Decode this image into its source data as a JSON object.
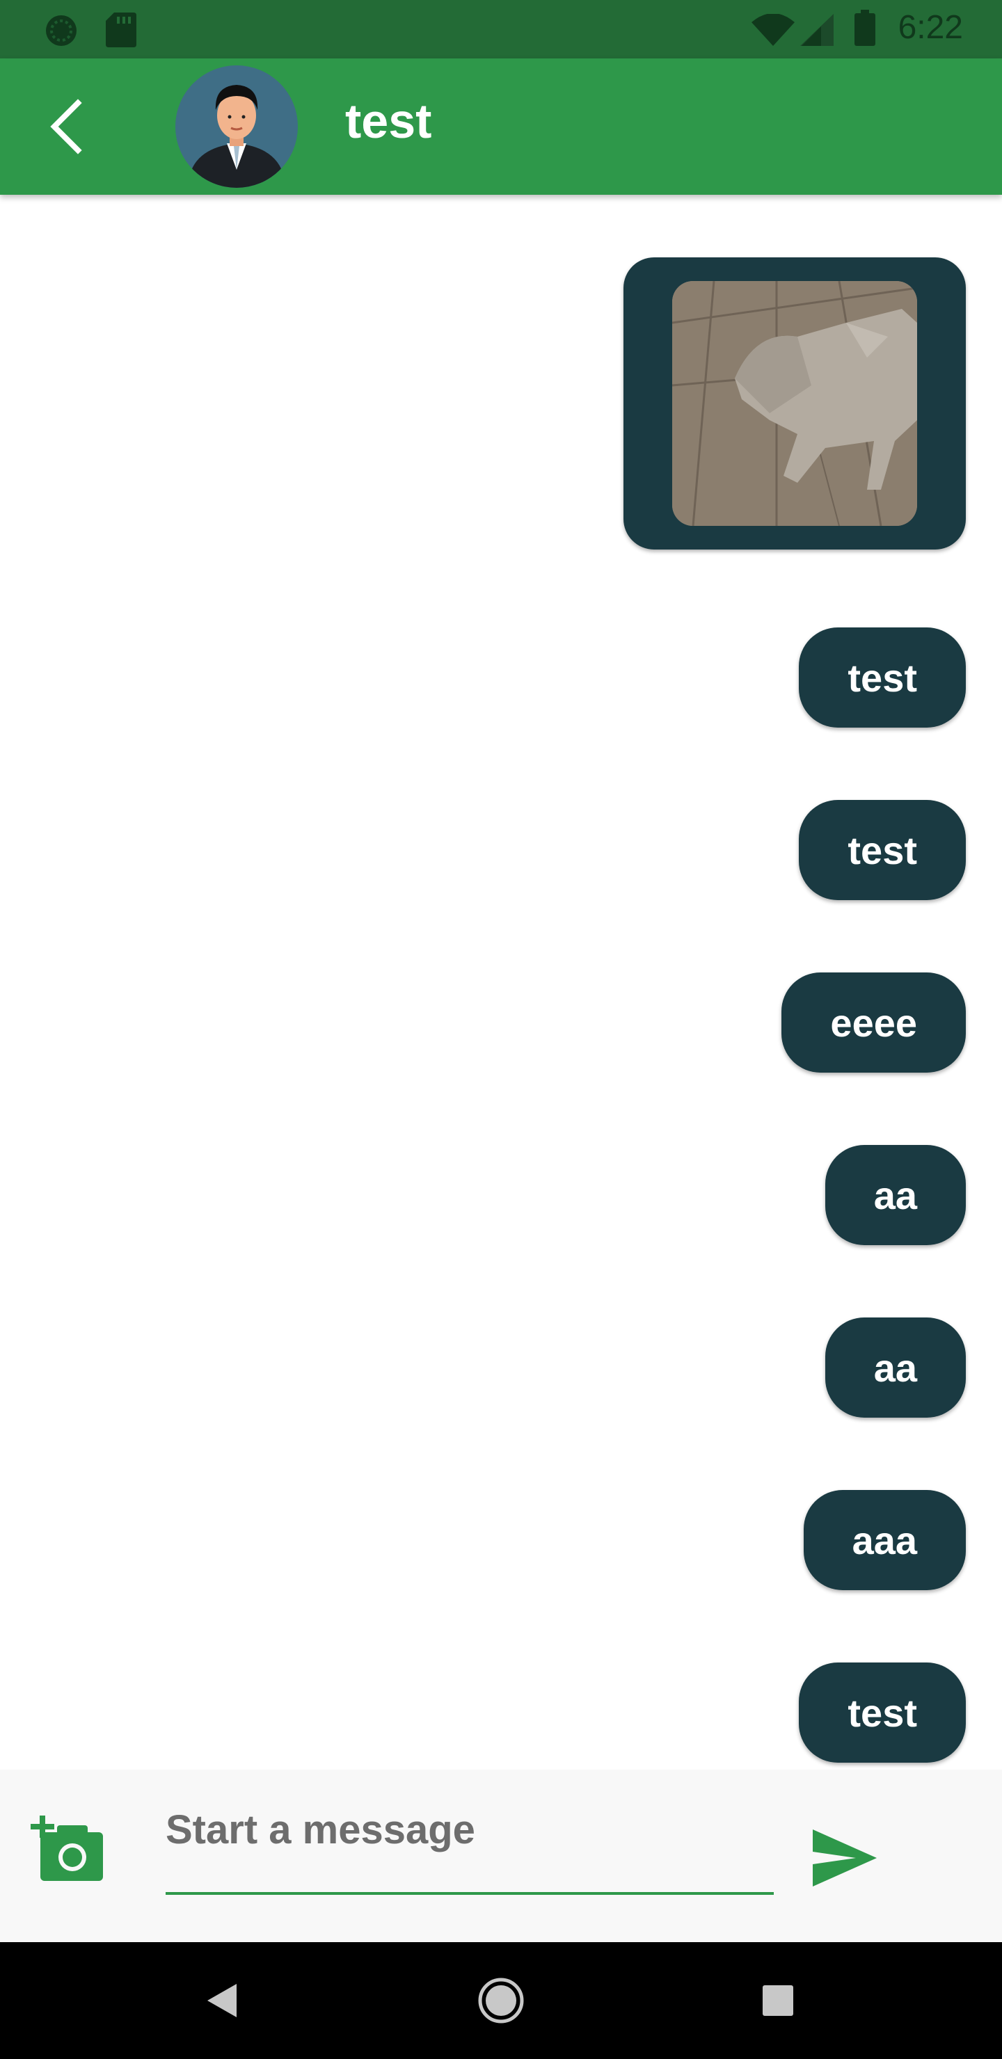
{
  "status_bar": {
    "time": "6:22",
    "icons": [
      "sync-icon",
      "sd-card-icon",
      "wifi-icon",
      "signal-icon",
      "battery-icon"
    ]
  },
  "app_bar": {
    "back_icon": "chevron-left-icon",
    "title": "test",
    "avatar": "businessman-avatar"
  },
  "messages": [
    {
      "type": "image",
      "content": "dog-photo"
    },
    {
      "type": "text",
      "text": "test"
    },
    {
      "type": "text",
      "text": "test"
    },
    {
      "type": "text",
      "text": "eeee"
    },
    {
      "type": "text",
      "text": "aa"
    },
    {
      "type": "text",
      "text": "aa"
    },
    {
      "type": "text",
      "text": "aaa"
    },
    {
      "type": "text",
      "text": "test"
    }
  ],
  "composer": {
    "placeholder": "Start a message",
    "value": "",
    "camera_icon": "add-photo-icon",
    "send_icon": "send-icon"
  },
  "nav_bar": {
    "icons": [
      "nav-back-icon",
      "nav-home-icon",
      "nav-recents-icon"
    ]
  },
  "colors": {
    "status_bar": "#236b36",
    "app_bar": "#2e984a",
    "bubble": "#1a3a42",
    "accent": "#2e984a"
  }
}
